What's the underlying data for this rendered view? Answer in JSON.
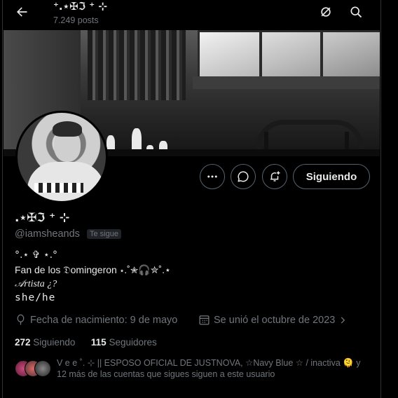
{
  "header": {
    "back_icon": "arrow-left-icon",
    "title": "⁺.⋆✠ℑ ⁺ ⊹",
    "posts": "7.249 posts",
    "hide_icon": "eye-off-icon",
    "search_icon": "search-icon"
  },
  "profile": {
    "name": ".⋆✠ℑ ⁺ ⊹",
    "handle": "@iamsheands",
    "follows_you_badge": "Te sigue",
    "bio_line1": "°.⋆ ✞ ⋆.°",
    "bio_line2": "Fan de los 𝔇omingeron ⋆.˚✮🎧✮˚.⋆",
    "bio_line3": "𝒜rtista ¿?",
    "bio_line4": "she/he",
    "birthday": "Fecha de nacimiento: 9 de mayo",
    "joined": "Se unió el octubre de 2023",
    "following_count": "272",
    "following_label": "Siguiendo",
    "followers_count": "115",
    "followers_label": "Seguidores",
    "known_followers_text": "V e e ˚. ⊹   || ESPOSO OFICIAL DE JUSTNOVA, ☆Navy Blue ☆ / inactiva 🫠 y 12 más de las cuentas que sigues siguen a este usuario"
  },
  "actions": {
    "more_icon": "more-dots-icon",
    "message_icon": "message-bubble-icon",
    "notify_icon": "bell-plus-icon",
    "follow_label": "Siguiendo"
  },
  "colors": {
    "background": "#000000",
    "text": "#e7e9ea",
    "secondary": "#71767b",
    "border": "#536471"
  }
}
